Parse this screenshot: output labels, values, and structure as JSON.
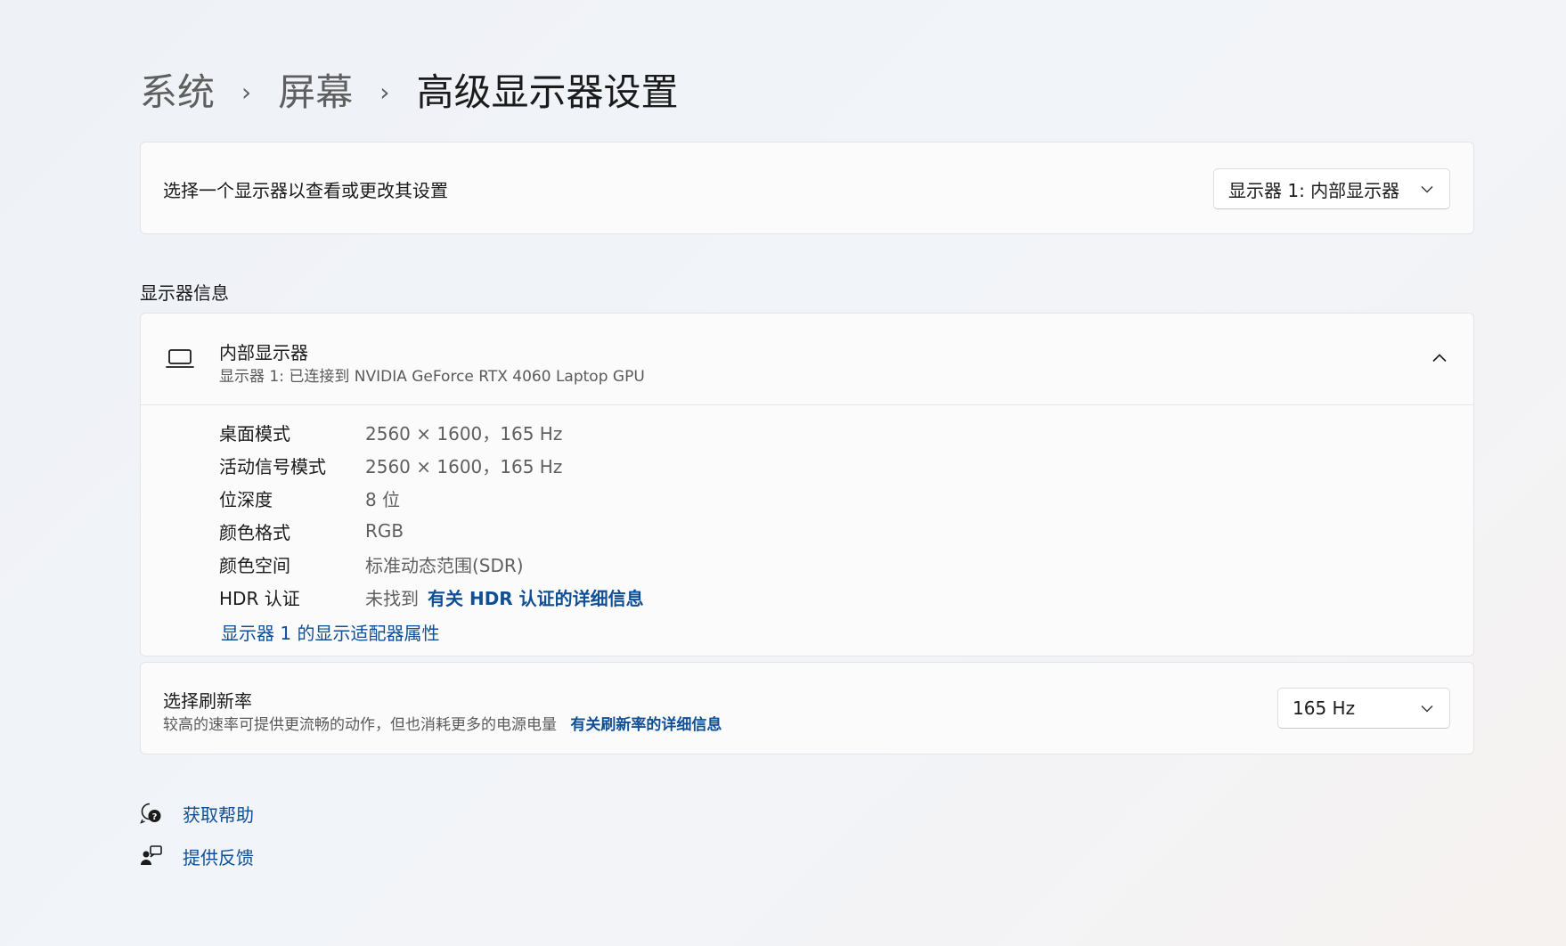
{
  "breadcrumb": {
    "items": [
      "系统",
      "屏幕",
      "高级显示器设置"
    ],
    "separator": "›"
  },
  "display_select": {
    "label": "选择一个显示器以查看或更改其设置",
    "selected": "显示器 1: 内部显示器"
  },
  "display_info": {
    "section_title": "显示器信息",
    "name": "内部显示器",
    "subtitle": "显示器 1: 已连接到 NVIDIA GeForce RTX 4060 Laptop GPU",
    "rows": [
      {
        "key": "桌面模式",
        "value": "2560 × 1600，165 Hz"
      },
      {
        "key": "活动信号模式",
        "value": "2560 × 1600，165 Hz"
      },
      {
        "key": "位深度",
        "value": "8 位"
      },
      {
        "key": "颜色格式",
        "value": "RGB"
      },
      {
        "key": "颜色空间",
        "value": "标准动态范围(SDR)"
      },
      {
        "key": "HDR 认证",
        "value": "未找到",
        "link": "有关 HDR 认证的详细信息"
      }
    ],
    "adapter_link": "显示器 1 的显示适配器属性"
  },
  "refresh_rate": {
    "title": "选择刷新率",
    "description": "较高的速率可提供更流畅的动作，但也消耗更多的电源电量",
    "link": "有关刷新率的详细信息",
    "selected": "165 Hz"
  },
  "footer": {
    "help": "获取帮助",
    "feedback": "提供反馈"
  },
  "colors": {
    "accent_link": "#0f4f96",
    "text_primary": "#1b1b1b",
    "text_secondary": "#5f5f5f",
    "card_bg": "#fbfbfc"
  },
  "icons": {
    "display": "laptop-icon",
    "collapse": "chevron-up-icon",
    "dropdown": "chevron-down-icon",
    "help": "help-chat-icon",
    "feedback": "feedback-person-icon"
  }
}
